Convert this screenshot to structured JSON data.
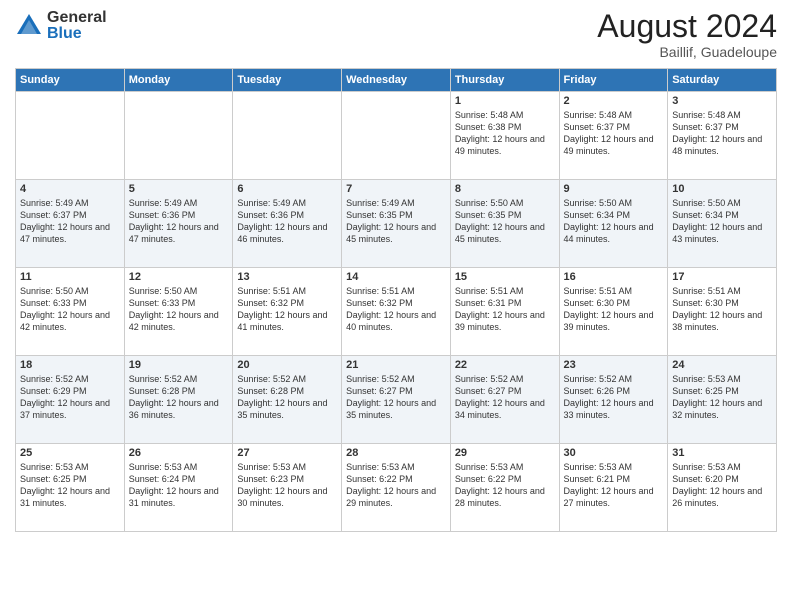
{
  "logo": {
    "general": "General",
    "blue": "Blue"
  },
  "title": "August 2024",
  "location": "Baillif, Guadeloupe",
  "days_of_week": [
    "Sunday",
    "Monday",
    "Tuesday",
    "Wednesday",
    "Thursday",
    "Friday",
    "Saturday"
  ],
  "weeks": [
    [
      {
        "day": "",
        "detail": ""
      },
      {
        "day": "",
        "detail": ""
      },
      {
        "day": "",
        "detail": ""
      },
      {
        "day": "",
        "detail": ""
      },
      {
        "day": "1",
        "detail": "Sunrise: 5:48 AM\nSunset: 6:38 PM\nDaylight: 12 hours\nand 49 minutes."
      },
      {
        "day": "2",
        "detail": "Sunrise: 5:48 AM\nSunset: 6:37 PM\nDaylight: 12 hours\nand 49 minutes."
      },
      {
        "day": "3",
        "detail": "Sunrise: 5:48 AM\nSunset: 6:37 PM\nDaylight: 12 hours\nand 48 minutes."
      }
    ],
    [
      {
        "day": "4",
        "detail": "Sunrise: 5:49 AM\nSunset: 6:37 PM\nDaylight: 12 hours\nand 47 minutes."
      },
      {
        "day": "5",
        "detail": "Sunrise: 5:49 AM\nSunset: 6:36 PM\nDaylight: 12 hours\nand 47 minutes."
      },
      {
        "day": "6",
        "detail": "Sunrise: 5:49 AM\nSunset: 6:36 PM\nDaylight: 12 hours\nand 46 minutes."
      },
      {
        "day": "7",
        "detail": "Sunrise: 5:49 AM\nSunset: 6:35 PM\nDaylight: 12 hours\nand 45 minutes."
      },
      {
        "day": "8",
        "detail": "Sunrise: 5:50 AM\nSunset: 6:35 PM\nDaylight: 12 hours\nand 45 minutes."
      },
      {
        "day": "9",
        "detail": "Sunrise: 5:50 AM\nSunset: 6:34 PM\nDaylight: 12 hours\nand 44 minutes."
      },
      {
        "day": "10",
        "detail": "Sunrise: 5:50 AM\nSunset: 6:34 PM\nDaylight: 12 hours\nand 43 minutes."
      }
    ],
    [
      {
        "day": "11",
        "detail": "Sunrise: 5:50 AM\nSunset: 6:33 PM\nDaylight: 12 hours\nand 42 minutes."
      },
      {
        "day": "12",
        "detail": "Sunrise: 5:50 AM\nSunset: 6:33 PM\nDaylight: 12 hours\nand 42 minutes."
      },
      {
        "day": "13",
        "detail": "Sunrise: 5:51 AM\nSunset: 6:32 PM\nDaylight: 12 hours\nand 41 minutes."
      },
      {
        "day": "14",
        "detail": "Sunrise: 5:51 AM\nSunset: 6:32 PM\nDaylight: 12 hours\nand 40 minutes."
      },
      {
        "day": "15",
        "detail": "Sunrise: 5:51 AM\nSunset: 6:31 PM\nDaylight: 12 hours\nand 39 minutes."
      },
      {
        "day": "16",
        "detail": "Sunrise: 5:51 AM\nSunset: 6:30 PM\nDaylight: 12 hours\nand 39 minutes."
      },
      {
        "day": "17",
        "detail": "Sunrise: 5:51 AM\nSunset: 6:30 PM\nDaylight: 12 hours\nand 38 minutes."
      }
    ],
    [
      {
        "day": "18",
        "detail": "Sunrise: 5:52 AM\nSunset: 6:29 PM\nDaylight: 12 hours\nand 37 minutes."
      },
      {
        "day": "19",
        "detail": "Sunrise: 5:52 AM\nSunset: 6:28 PM\nDaylight: 12 hours\nand 36 minutes."
      },
      {
        "day": "20",
        "detail": "Sunrise: 5:52 AM\nSunset: 6:28 PM\nDaylight: 12 hours\nand 35 minutes."
      },
      {
        "day": "21",
        "detail": "Sunrise: 5:52 AM\nSunset: 6:27 PM\nDaylight: 12 hours\nand 35 minutes."
      },
      {
        "day": "22",
        "detail": "Sunrise: 5:52 AM\nSunset: 6:27 PM\nDaylight: 12 hours\nand 34 minutes."
      },
      {
        "day": "23",
        "detail": "Sunrise: 5:52 AM\nSunset: 6:26 PM\nDaylight: 12 hours\nand 33 minutes."
      },
      {
        "day": "24",
        "detail": "Sunrise: 5:53 AM\nSunset: 6:25 PM\nDaylight: 12 hours\nand 32 minutes."
      }
    ],
    [
      {
        "day": "25",
        "detail": "Sunrise: 5:53 AM\nSunset: 6:25 PM\nDaylight: 12 hours\nand 31 minutes."
      },
      {
        "day": "26",
        "detail": "Sunrise: 5:53 AM\nSunset: 6:24 PM\nDaylight: 12 hours\nand 31 minutes."
      },
      {
        "day": "27",
        "detail": "Sunrise: 5:53 AM\nSunset: 6:23 PM\nDaylight: 12 hours\nand 30 minutes."
      },
      {
        "day": "28",
        "detail": "Sunrise: 5:53 AM\nSunset: 6:22 PM\nDaylight: 12 hours\nand 29 minutes."
      },
      {
        "day": "29",
        "detail": "Sunrise: 5:53 AM\nSunset: 6:22 PM\nDaylight: 12 hours\nand 28 minutes."
      },
      {
        "day": "30",
        "detail": "Sunrise: 5:53 AM\nSunset: 6:21 PM\nDaylight: 12 hours\nand 27 minutes."
      },
      {
        "day": "31",
        "detail": "Sunrise: 5:53 AM\nSunset: 6:20 PM\nDaylight: 12 hours\nand 26 minutes."
      }
    ]
  ]
}
